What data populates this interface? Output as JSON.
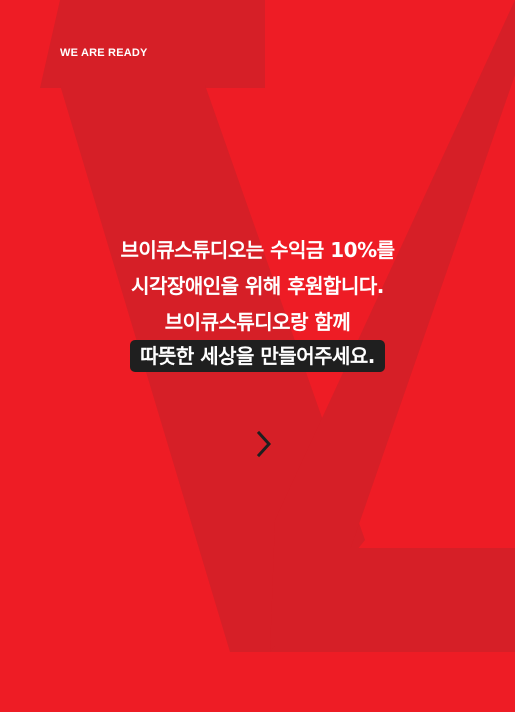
{
  "colors": {
    "background": "#ee1c25",
    "watermark": "#d61f27",
    "text": "#ffffff",
    "highlight_bg": "#1f1f1f",
    "arrow": "#1f1f1f"
  },
  "eyebrow": "WE ARE READY",
  "message": {
    "line1": "브이큐스튜디오는 수익금 10%를",
    "line2": "시각장애인을 위해 후원합니다.",
    "line3": "브이큐스튜디오랑 함께",
    "highlight": "따뜻한 세상을 만들어주세요."
  },
  "next": {
    "icon": "chevron-right-icon"
  }
}
